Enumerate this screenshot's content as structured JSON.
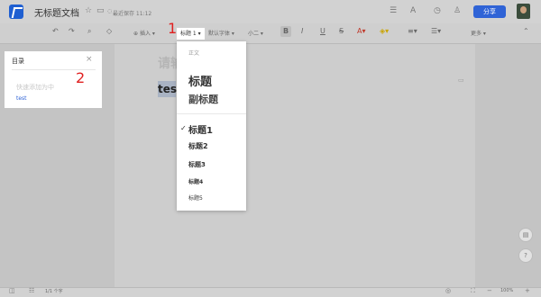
{
  "header": {
    "title": "无标题文档",
    "saved_status": "最近保存 11:12",
    "share_label": "分享"
  },
  "toolbar": {
    "insert_label": "插入",
    "heading_label": "标题 1",
    "font_label": "默认字体",
    "size_label": "小二",
    "more_label": "更多"
  },
  "heading_menu": {
    "items": [
      {
        "label": "正文",
        "selected": false
      },
      {
        "label": "标题",
        "selected": false
      },
      {
        "label": "副标题",
        "selected": false
      },
      {
        "label": "标题1",
        "selected": true
      },
      {
        "label": "标题2",
        "selected": false
      },
      {
        "label": "标题3",
        "selected": false
      },
      {
        "label": "标题4",
        "selected": false
      },
      {
        "label": "标题5",
        "selected": false
      }
    ],
    "check_mark": "✓"
  },
  "outline_panel": {
    "title": "目录",
    "hint": "快速添加为中",
    "link": "test"
  },
  "document": {
    "placeholder": "请输",
    "text": "test"
  },
  "status_bar": {
    "word_count": "1/1 个字",
    "zoom": "100%"
  },
  "annotations": {
    "one": "1",
    "two": "2"
  },
  "colors": {
    "accent": "#2f63d6",
    "annotation": "#e02020"
  }
}
